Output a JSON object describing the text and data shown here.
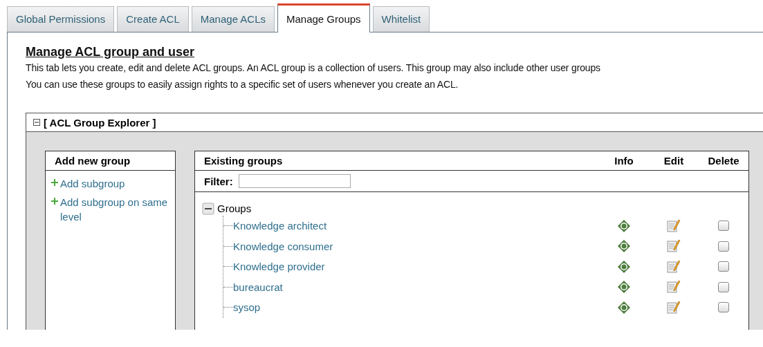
{
  "tabs": [
    {
      "label": "Global Permissions",
      "selected": false
    },
    {
      "label": "Create ACL",
      "selected": false
    },
    {
      "label": "Manage ACLs",
      "selected": false
    },
    {
      "label": "Manage Groups",
      "selected": true
    },
    {
      "label": "Whitelist",
      "selected": false
    }
  ],
  "heading": "Manage ACL group and user",
  "description": [
    "This tab lets you create, edit and delete ACL groups. An ACL group is a collection of users. This group may also include other user groups",
    "You can use these groups to easily assign rights to a specific set of users whenever you create an ACL."
  ],
  "explorer": {
    "title": "[ ACL Group Explorer ]",
    "expanded": true,
    "add_panel": {
      "title": "Add new group",
      "links": [
        "Add subgroup",
        "Add subgroup on same level"
      ]
    },
    "groups_panel": {
      "title": "Existing groups",
      "columns": [
        "Info",
        "Edit",
        "Delete"
      ],
      "filter": {
        "label": "Filter:"
      },
      "tree": {
        "label": "Groups",
        "expanded": true,
        "children": [
          {
            "label": "Knowledge architect",
            "delete_checked": false
          },
          {
            "label": "Knowledge consumer",
            "delete_checked": false
          },
          {
            "label": "Knowledge provider",
            "delete_checked": false
          },
          {
            "label": "bureaucrat",
            "delete_checked": false
          },
          {
            "label": "sysop",
            "delete_checked": false
          }
        ]
      }
    }
  }
}
